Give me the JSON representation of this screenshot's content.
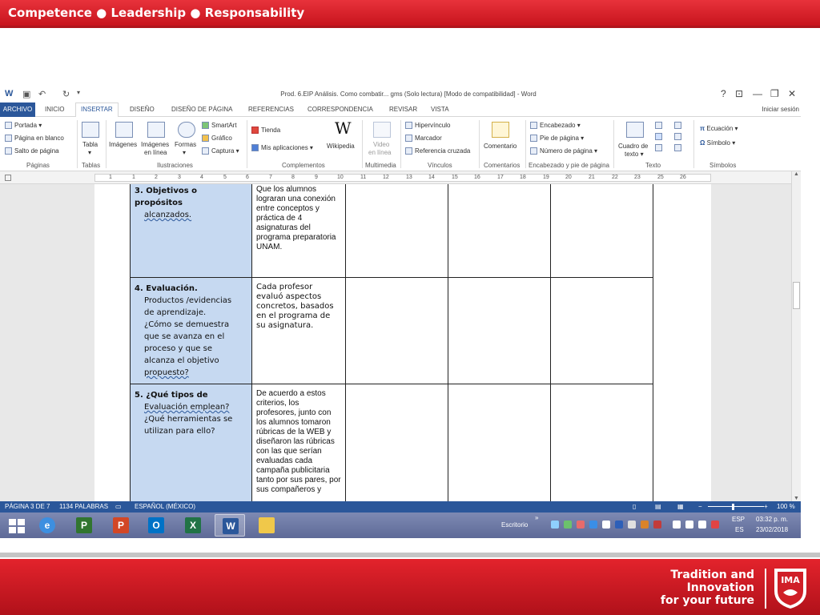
{
  "slide": {
    "header": "Competence ● Leadership ● Responsability",
    "tagline": [
      "Tradition and",
      "Innovation",
      "for your future"
    ],
    "logo_text": "IMA"
  },
  "window": {
    "title": "Prod. 6.EIP Análisis. Como combatir... gms (Solo lectura) [Modo de compatibilidad] - Word",
    "controls": [
      "?",
      "⊡",
      "—",
      "❐",
      "✕"
    ]
  },
  "menu": {
    "tabs": [
      "ARCHIVO",
      "INICIO",
      "INSERTAR",
      "DISEÑO",
      "DISEÑO DE PÁGINA",
      "REFERENCIAS",
      "CORRESPONDENCIA",
      "REVISAR",
      "VISTA"
    ],
    "active": "INSERTAR",
    "signin": "Iniciar sesión"
  },
  "ribbon": {
    "paginas": [
      "Portada ▾",
      "Página en blanco",
      "Salto de página"
    ],
    "tabla": [
      "Tabla",
      "▾"
    ],
    "ilustraciones": [
      "Imágenes",
      "Imágenes",
      "en línea",
      "Formas",
      "▾",
      "SmartArt",
      "Gráfico",
      "Captura ▾"
    ],
    "complementos": [
      "Tienda",
      "Mis aplicaciones ▾",
      "Wikipedia"
    ],
    "multimedia": [
      "Video",
      "en línea"
    ],
    "vinculos": [
      "Hipervínculo",
      "Marcador",
      "Referencia cruzada"
    ],
    "comentarios": [
      "Comentario"
    ],
    "encabezado": [
      "Encabezado ▾",
      "Pie de página ▾",
      "Número de página ▾"
    ],
    "texto": [
      "Cuadro de",
      "texto ▾"
    ],
    "simbolos": [
      "Ecuación ▾",
      "Símbolo ▾"
    ],
    "groups": [
      "Páginas",
      "Tablas",
      "Ilustraciones",
      "Complementos",
      "Multimedia",
      "Vínculos",
      "Comentarios",
      "Encabezado y pie de página",
      "Texto",
      "Símbolos"
    ]
  },
  "ruler_numbers": [
    "1",
    "1",
    "2",
    "3",
    "4",
    "5",
    "6",
    "7",
    "8",
    "9",
    "10",
    "11",
    "12",
    "13",
    "14",
    "15",
    "16",
    "17",
    "18",
    "19",
    "20",
    "21",
    "22",
    "23",
    "25",
    "26"
  ],
  "table": {
    "rows": [
      {
        "head": "3. Objetivos o propósitos",
        "head_lines": [
          "alcanzados."
        ],
        "content": "Que los alumnos lograran una conexión entre conceptos y práctica de 4 asignaturas del programa preparatoria UNAM."
      },
      {
        "head": "4. Evaluación.",
        "head_lines": [
          "Productos /evidencias",
          "de aprendizaje.",
          "¿Cómo  se demuestra",
          "que se avanza en el",
          "proceso  y que se",
          "alcanza el objetivo",
          "propuesto?"
        ],
        "content": "Cada profesor evaluó aspectos concretos, basados en el programa de su asignatura."
      },
      {
        "head": "5. ¿Qué tipos de",
        "head_lines": [
          "Evaluación emplean?",
          "¿Qué herramientas se",
          " utilizan para ello?"
        ],
        "content": "De acuerdo a estos criterios, los profesores, junto con los alumnos tomaron rúbricas de la WEB y diseñaron las rúbricas con las que serían evaluadas cada campaña publicitaria tanto por sus pares, por sus compañeros y"
      }
    ]
  },
  "status": {
    "page": "PÁGINA 3 DE 7",
    "words": "1134 PALABRAS",
    "lang": "ESPAÑOL (MÉXICO)",
    "zoom": "100 %"
  },
  "taskbar": {
    "apps": [
      "ie",
      "project",
      "powerpoint",
      "outlook",
      "excel",
      "word",
      "explorer"
    ],
    "escritorio": "Escritorio",
    "lang_top": "ESP",
    "lang_bottom": "ES",
    "time": "03:32 p. m.",
    "date": "23/02/2018"
  }
}
